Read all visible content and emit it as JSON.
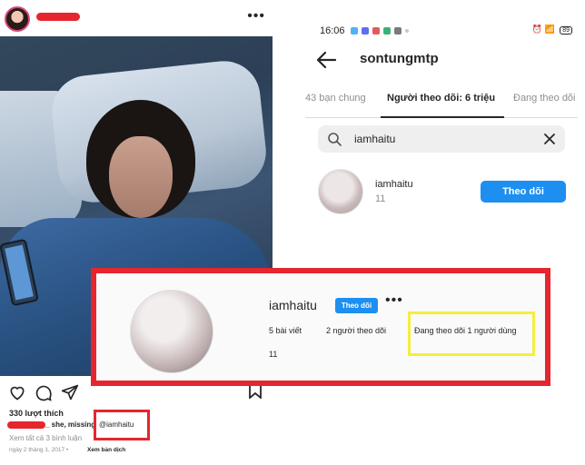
{
  "post": {
    "more_icon": "more-dots-icon",
    "likes": "330 lượt thích",
    "caption": "_ she, missing",
    "tagged_user": "@iamhaitu",
    "view_comments": "Xem tất cả 3 bình luận",
    "date": "ngày 2 tháng 1, 2017 •",
    "see_translation": "Xem bản dịch"
  },
  "mobile": {
    "status": {
      "time": "16:06",
      "battery": "89"
    },
    "title": "sontungmtp",
    "tabs": [
      "43 bạn chung",
      "Người theo dõi: 6 triệu",
      "Đang theo dõi"
    ],
    "search": {
      "value": "iamhaitu"
    },
    "result": {
      "username": "iamhaitu",
      "subtitle": "11",
      "follow_label": "Theo dõi"
    }
  },
  "profile_card": {
    "username": "iamhaitu",
    "follow_label": "Theo dõi",
    "posts": "5 bài viết",
    "followers": "2 người theo dõi",
    "following": "Đang theo dõi 1 người dùng",
    "subtitle": "11"
  },
  "colors": {
    "highlight_red": "#e5262e",
    "highlight_yellow": "#f5ee3a",
    "button_blue": "#1d8ff0"
  }
}
